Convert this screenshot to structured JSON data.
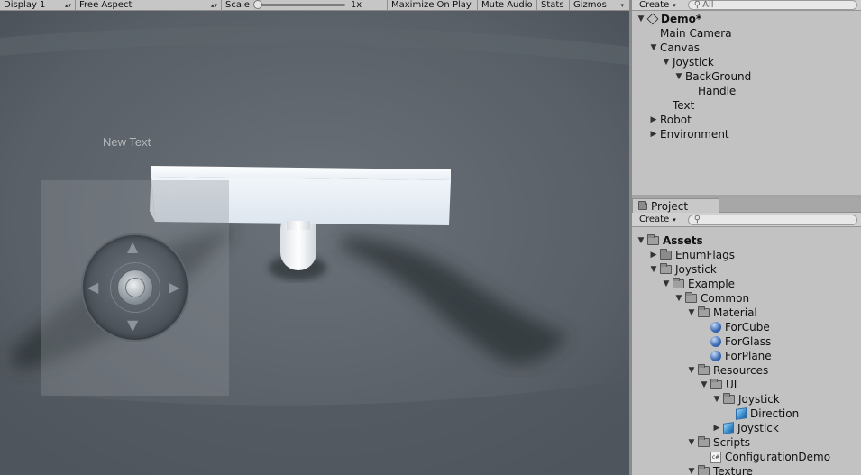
{
  "game_toolbar": {
    "display": "Display 1",
    "aspect": "Free Aspect",
    "scale_label": "Scale",
    "scale_value": "1x",
    "scale_fraction": 0.0,
    "maximize": "Maximize On Play",
    "mute": "Mute Audio",
    "stats": "Stats",
    "gizmos": "Gizmos"
  },
  "game_view": {
    "ui_text": "New Text"
  },
  "hierarchy": {
    "create": "Create",
    "search_placeholder": "All",
    "items": [
      {
        "label": "Demo*",
        "depth": 0,
        "expanded": true,
        "bold": true,
        "icon": "unity-scene-icon"
      },
      {
        "label": "Main Camera",
        "depth": 1,
        "expanded": null
      },
      {
        "label": "Canvas",
        "depth": 1,
        "expanded": true
      },
      {
        "label": "Joystick",
        "depth": 2,
        "expanded": true
      },
      {
        "label": "BackGround",
        "depth": 3,
        "expanded": true
      },
      {
        "label": "Handle",
        "depth": 4,
        "expanded": null
      },
      {
        "label": "Text",
        "depth": 2,
        "expanded": null
      },
      {
        "label": "Robot",
        "depth": 1,
        "expanded": false
      },
      {
        "label": "Environment",
        "depth": 1,
        "expanded": false
      }
    ]
  },
  "project": {
    "tab": "Project",
    "create": "Create",
    "items": [
      {
        "label": "Assets",
        "depth": 0,
        "expanded": true,
        "bold": true,
        "icon": "folder"
      },
      {
        "label": "EnumFlags",
        "depth": 1,
        "expanded": false,
        "icon": "folder"
      },
      {
        "label": "Joystick",
        "depth": 1,
        "expanded": true,
        "icon": "folder"
      },
      {
        "label": "Example",
        "depth": 2,
        "expanded": true,
        "icon": "folder"
      },
      {
        "label": "Common",
        "depth": 3,
        "expanded": true,
        "icon": "folder"
      },
      {
        "label": "Material",
        "depth": 4,
        "expanded": true,
        "icon": "folder"
      },
      {
        "label": "ForCube",
        "depth": 5,
        "expanded": null,
        "icon": "material"
      },
      {
        "label": "ForGlass",
        "depth": 5,
        "expanded": null,
        "icon": "material"
      },
      {
        "label": "ForPlane",
        "depth": 5,
        "expanded": null,
        "icon": "material"
      },
      {
        "label": "Resources",
        "depth": 4,
        "expanded": true,
        "icon": "folder"
      },
      {
        "label": "UI",
        "depth": 5,
        "expanded": true,
        "icon": "folder"
      },
      {
        "label": "Joystick",
        "depth": 6,
        "expanded": true,
        "icon": "folder"
      },
      {
        "label": "Direction",
        "depth": 7,
        "expanded": null,
        "icon": "prefab"
      },
      {
        "label": "Joystick",
        "depth": 6,
        "expanded": false,
        "icon": "prefab"
      },
      {
        "label": "Scripts",
        "depth": 4,
        "expanded": true,
        "icon": "folder"
      },
      {
        "label": "ConfigurationDemo",
        "depth": 5,
        "expanded": null,
        "icon": "cs"
      },
      {
        "label": "Texture",
        "depth": 4,
        "expanded": true,
        "icon": "folder"
      }
    ]
  }
}
